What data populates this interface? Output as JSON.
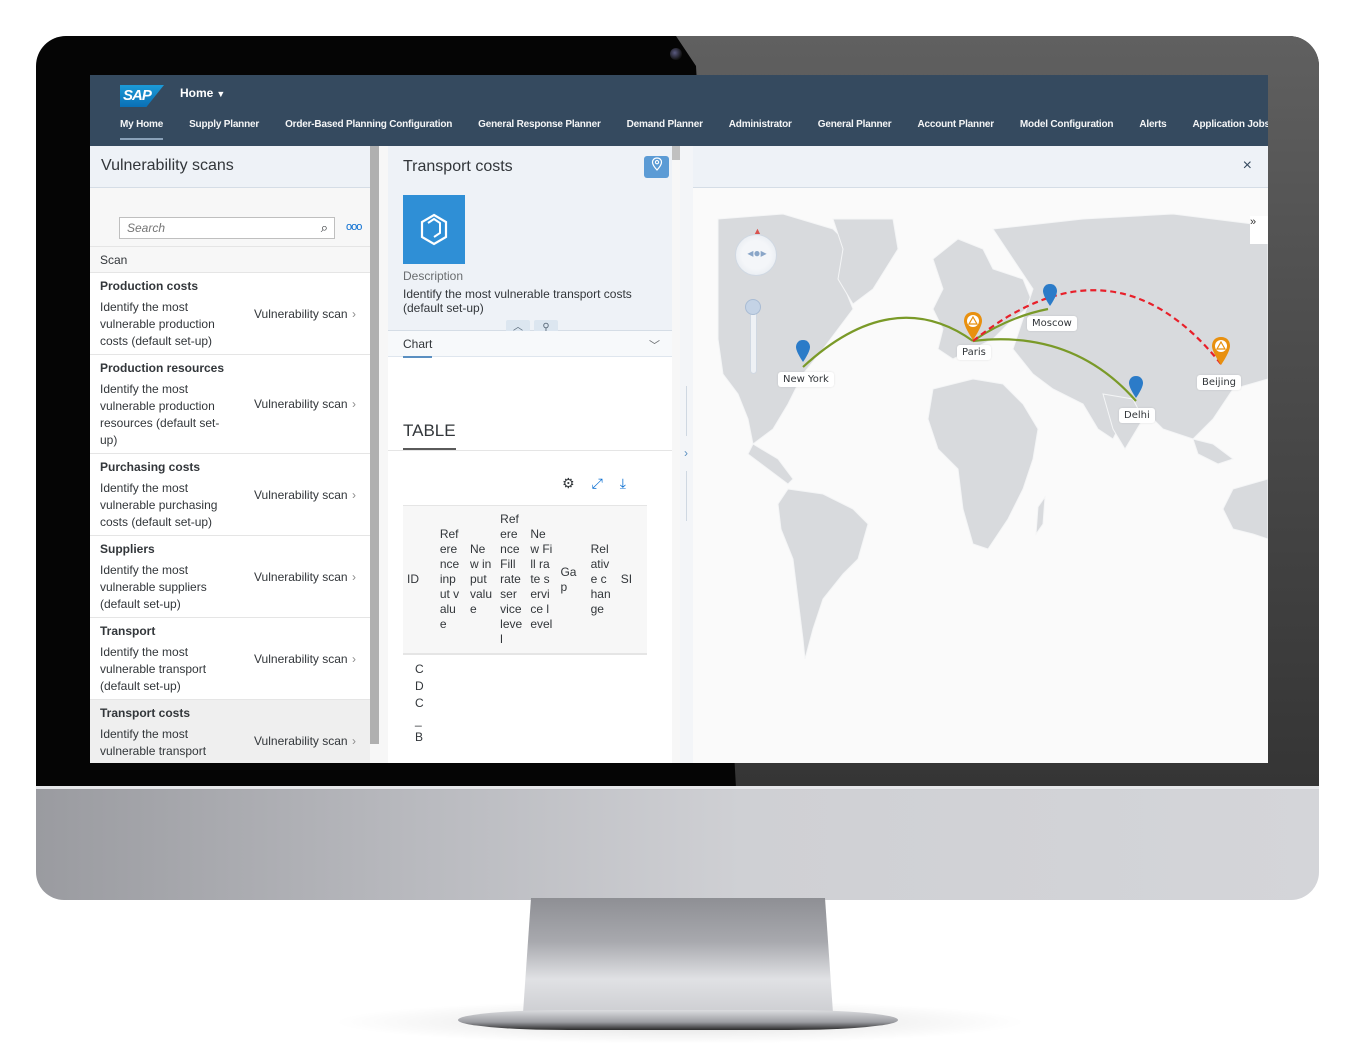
{
  "shell": {
    "logo": "SAP",
    "home_menu": "Home",
    "tabs": [
      {
        "label": "My Home",
        "active": true
      },
      {
        "label": "Supply Planner"
      },
      {
        "label": "Order-Based Planning Configuration"
      },
      {
        "label": "General Response Planner"
      },
      {
        "label": "Demand Planner"
      },
      {
        "label": "Administrator"
      },
      {
        "label": "General Planner"
      },
      {
        "label": "Account Planner"
      },
      {
        "label": "Model Configuration"
      },
      {
        "label": "Alerts"
      },
      {
        "label": "Application Jobs"
      }
    ]
  },
  "left_pane": {
    "title": "Vulnerability scans",
    "search_placeholder": "Search",
    "more_icon": "ooo",
    "column_header": "Scan",
    "items": [
      {
        "title": "Production costs",
        "description": "Identify the most vulnerable production costs (default set-up)",
        "type": "Vulnerability scan"
      },
      {
        "title": "Production resources",
        "description": "Identify the most vulnerable production resources (default set-up)",
        "type": "Vulnerability scan"
      },
      {
        "title": "Purchasing costs",
        "description": "Identify the most vulnerable purchasing costs (default set-up)",
        "type": "Vulnerability scan"
      },
      {
        "title": "Suppliers",
        "description": "Identify the most vulnerable suppliers (default set-up)",
        "type": "Vulnerability scan"
      },
      {
        "title": "Transport",
        "description": "Identify the most vulnerable transport (default set-up)",
        "type": "Vulnerability scan"
      },
      {
        "title": "Transport costs",
        "description": "Identify the most vulnerable transport",
        "type": "Vulnerability scan",
        "selected": true
      }
    ]
  },
  "mid_pane": {
    "title": "Transport costs",
    "description_label": "Description",
    "description": "Identify the most vulnerable transport costs (default set-up)",
    "section_tab": "Chart",
    "table_title": "TABLE",
    "table": {
      "columns": [
        "ID",
        "Reference input value",
        "New input value",
        "Reference Fill rate service level",
        "New Fill rate service level",
        "Gap",
        "Relative change",
        "SI"
      ],
      "rows": [
        [
          "CDC_B"
        ]
      ]
    }
  },
  "map": {
    "close_label": "×",
    "cities": [
      {
        "name": "New York",
        "type": "location",
        "color": "#2b7bc8"
      },
      {
        "name": "Paris",
        "type": "warning",
        "color": "#e8900f"
      },
      {
        "name": "Moscow",
        "type": "location",
        "color": "#2b7bc8"
      },
      {
        "name": "Delhi",
        "type": "location",
        "color": "#2b7bc8"
      },
      {
        "name": "Beijing",
        "type": "warning",
        "color": "#e8900f"
      }
    ],
    "routes": [
      {
        "from": "New York",
        "to": "Paris",
        "style": "solid",
        "color": "#7a9a28"
      },
      {
        "from": "Paris",
        "to": "Moscow",
        "style": "solid",
        "color": "#7a9a28"
      },
      {
        "from": "Paris",
        "to": "Delhi",
        "style": "solid",
        "color": "#7a9a28"
      },
      {
        "from": "Paris",
        "to": "Beijing",
        "style": "dashed",
        "color": "#e8202a"
      }
    ]
  }
}
